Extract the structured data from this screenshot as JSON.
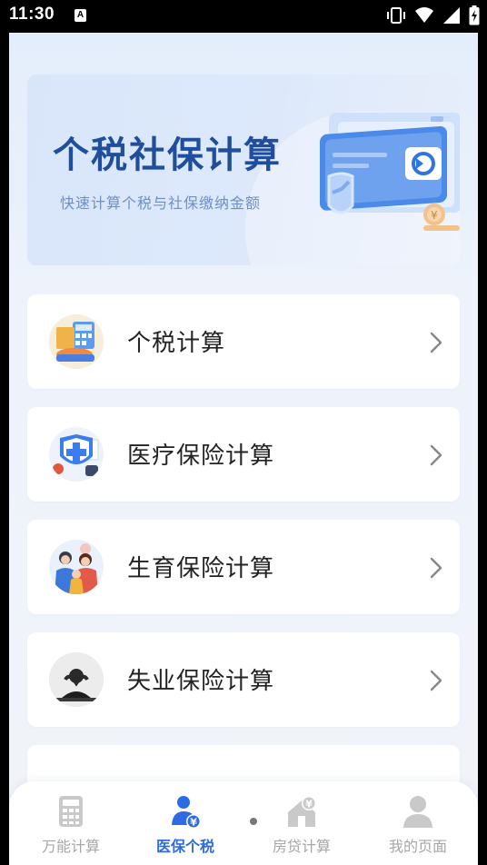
{
  "status_bar": {
    "time": "11:30",
    "sim_label": "A",
    "icons": [
      "vibrate-icon",
      "wifi-icon",
      "signal-icon",
      "battery-icon"
    ]
  },
  "banner": {
    "title": "个税社保计算",
    "subtitle": "快速计算个税与社保缴纳金额"
  },
  "menu": {
    "items": [
      {
        "label": "个税计算",
        "icon": "tax-calculator-icon"
      },
      {
        "label": "医疗保险计算",
        "icon": "medical-shield-icon"
      },
      {
        "label": "生育保险计算",
        "icon": "family-icon"
      },
      {
        "label": "失业保险计算",
        "icon": "unemployed-person-icon"
      }
    ]
  },
  "tabbar": {
    "tabs": [
      {
        "label": "万能计算",
        "icon": "calculator-icon",
        "active": false
      },
      {
        "label": "医保个税",
        "icon": "person-yen-icon",
        "active": true
      },
      {
        "label": "房贷计算",
        "icon": "house-yen-icon",
        "active": false
      },
      {
        "label": "我的页面",
        "icon": "user-icon",
        "active": false
      }
    ]
  },
  "colors": {
    "accent": "#2d6be3",
    "banner_title": "#1f4e9c",
    "inactive_tab": "#a6a6a6"
  }
}
